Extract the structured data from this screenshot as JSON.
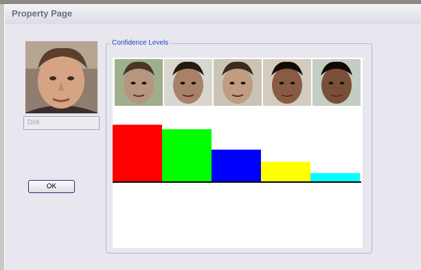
{
  "window": {
    "title": "Property Page"
  },
  "profile": {
    "photo_icon": "person-photo",
    "name_value": "Dirk",
    "ok_label": "OK"
  },
  "confidence": {
    "group_label": "Confidence Levels",
    "faces": [
      {
        "skin": "#b7967f",
        "hair": "#4a3526",
        "bg": "#9fae8c"
      },
      {
        "skin": "#a88168",
        "hair": "#24190f",
        "bg": "#d8d6cf"
      },
      {
        "skin": "#bf9c82",
        "hair": "#3b2a1f",
        "bg": "#c9c4b6"
      },
      {
        "skin": "#8a5b44",
        "hair": "#120c08",
        "bg": "#d2ccbf"
      },
      {
        "skin": "#7a4f38",
        "hair": "#0e0906",
        "bg": "#c4cdc4"
      }
    ]
  },
  "chart_data": {
    "type": "bar",
    "categories": [
      "",
      "",
      "",
      "",
      ""
    ],
    "values": [
      0.75,
      0.69,
      0.42,
      0.26,
      0.11
    ],
    "colors": [
      "#ff0000",
      "#00ff00",
      "#0000ff",
      "#ffff00",
      "#00ffff"
    ],
    "ylim": [
      0,
      1
    ]
  }
}
